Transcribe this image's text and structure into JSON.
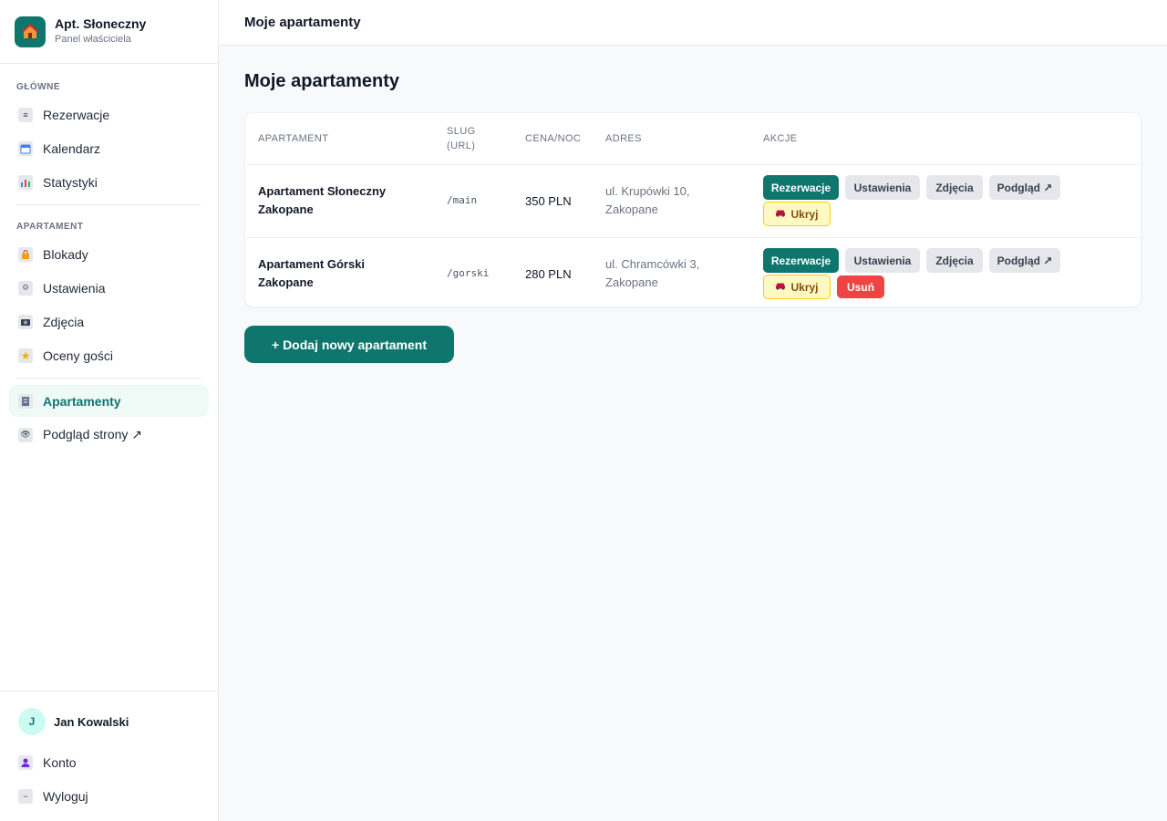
{
  "brand": {
    "title": "Apt. Słoneczny",
    "subtitle": "Panel właściciela"
  },
  "sidebar": {
    "sections": [
      {
        "label": "GŁÓWNE",
        "items": [
          {
            "label": "Rezerwacje",
            "icon": "list-icon"
          },
          {
            "label": "Kalendarz",
            "icon": "calendar-icon"
          },
          {
            "label": "Statystyki",
            "icon": "chart-icon"
          }
        ]
      },
      {
        "label": "APARTAMENT",
        "items": [
          {
            "label": "Blokady",
            "icon": "lock-icon"
          },
          {
            "label": "Ustawienia",
            "icon": "gear-icon"
          },
          {
            "label": "Zdjęcia",
            "icon": "camera-icon"
          },
          {
            "label": "Oceny gości",
            "icon": "star-icon"
          }
        ]
      }
    ],
    "extra": [
      {
        "label": "Apartamenty",
        "icon": "building-icon",
        "active": true
      },
      {
        "label": "Podgląd strony ↗",
        "icon": "eye-icon",
        "active": false
      }
    ],
    "user": {
      "initial": "J",
      "name": "Jan Kowalski"
    },
    "footer": [
      {
        "label": "Konto",
        "icon": "user-icon"
      },
      {
        "label": "Wyloguj",
        "icon": "logout-icon"
      }
    ]
  },
  "topbar": {
    "title": "Moje apartamenty"
  },
  "main": {
    "title": "Moje apartamenty",
    "table": {
      "headers": {
        "apartment": "APARTAMENT",
        "slug_1": "SLUG",
        "slug_2": "(URL)",
        "price": "CENA/NOC",
        "address": "ADRES",
        "actions": "AKCJE"
      },
      "rows": [
        {
          "name": "Apartament Słoneczny Zakopane",
          "slug": "/main",
          "price": "350 PLN",
          "address": "ul. Krupówki 10, Zakopane",
          "actions": {
            "reservations": "Rezerwacje",
            "settings": "Ustawienia",
            "photos": "Zdjęcia",
            "preview": "Podgląd ↗",
            "hide": "Ukryj"
          }
        },
        {
          "name": "Apartament Górski Zakopane",
          "slug": "/gorski",
          "price": "280 PLN",
          "address": "ul. Chramcówki 3, Zakopane",
          "actions": {
            "reservations": "Rezerwacje",
            "settings": "Ustawienia",
            "photos": "Zdjęcia",
            "preview": "Podgląd ↗",
            "hide": "Ukryj",
            "delete": "Usuń"
          }
        }
      ]
    },
    "add_button": "+ Dodaj nowy apartament"
  },
  "colors": {
    "accent": "#0f766e",
    "danger": "#ef4444",
    "warning_bg": "#fef9c3"
  }
}
